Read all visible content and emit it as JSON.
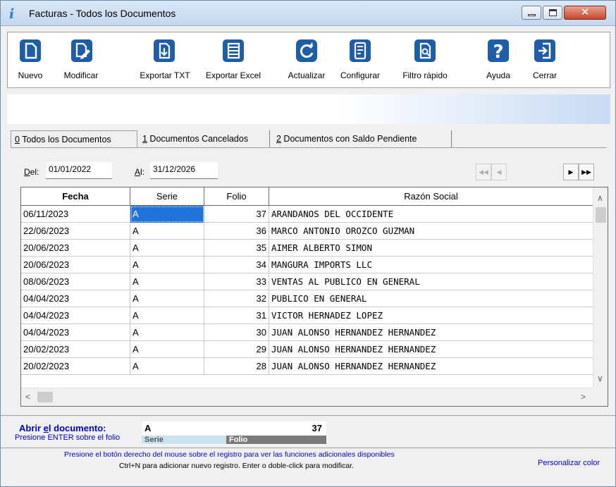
{
  "window": {
    "title": "Facturas - Todos los Documentos",
    "close_glyph": "✕"
  },
  "toolbar": {
    "buttons": [
      {
        "label": "Nuevo",
        "icon": "new-document-icon"
      },
      {
        "label": "Modificar",
        "icon": "edit-document-icon"
      },
      {
        "label": "Exportar TXT",
        "icon": "export-txt-icon"
      },
      {
        "label": "Exportar Excel",
        "icon": "export-excel-icon"
      },
      {
        "label": "Actualizar",
        "icon": "refresh-icon"
      },
      {
        "label": "Configurar",
        "icon": "configure-icon"
      },
      {
        "label": "Filtro rápido",
        "icon": "quick-filter-icon"
      },
      {
        "label": "Ayuda",
        "icon": "help-icon"
      },
      {
        "label": "Cerrar",
        "icon": "exit-door-icon"
      }
    ]
  },
  "tabs": [
    {
      "key": "0",
      "rest": " Todos los Documentos",
      "active": true
    },
    {
      "key": "1",
      "rest": " Documentos Cancelados",
      "active": false
    },
    {
      "key": "2",
      "rest": " Documentos con Saldo Pendiente",
      "active": false
    }
  ],
  "filters": {
    "del_key": "D",
    "del_rest": "el:",
    "del_value": "01/01/2022",
    "al_key": "A",
    "al_rest": "l:",
    "al_value": "31/12/2026"
  },
  "nav": {
    "first": "◀◀",
    "prev": "◀",
    "next": "▶",
    "last": "▶▶"
  },
  "grid": {
    "columns": [
      "Fecha",
      "Serie",
      "Folio",
      "Razón Social"
    ],
    "rows": [
      {
        "fecha": "06/11/2023",
        "serie": "A",
        "folio": "37",
        "razon": "ARANDANOS DEL OCCIDENTE"
      },
      {
        "fecha": "22/06/2023",
        "serie": "A",
        "folio": "36",
        "razon": "MARCO ANTONIO OROZCO GUZMAN"
      },
      {
        "fecha": "20/06/2023",
        "serie": "A",
        "folio": "35",
        "razon": "AIMER ALBERTO SIMON"
      },
      {
        "fecha": "20/06/2023",
        "serie": "A",
        "folio": "34",
        "razon": "MANGURA IMPORTS LLC"
      },
      {
        "fecha": "08/06/2023",
        "serie": "A",
        "folio": "33",
        "razon": "VENTAS AL PUBLICO EN GENERAL"
      },
      {
        "fecha": "04/04/2023",
        "serie": "A",
        "folio": "32",
        "razon": "PUBLICO EN GENERAL"
      },
      {
        "fecha": "04/04/2023",
        "serie": "A",
        "folio": "31",
        "razon": "VICTOR HERNADEZ LOPEZ"
      },
      {
        "fecha": "04/04/2023",
        "serie": "A",
        "folio": "30",
        "razon": "JUAN ALONSO HERNANDEZ HERNANDEZ"
      },
      {
        "fecha": "20/02/2023",
        "serie": "A",
        "folio": "29",
        "razon": "JUAN ALONSO HERNANDEZ HERNANDEZ"
      },
      {
        "fecha": "20/02/2023",
        "serie": "A",
        "folio": "28",
        "razon": "JUAN ALONSO HERNANDEZ HERNANDEZ"
      }
    ],
    "scroll_up": "∧",
    "scroll_down": "∨",
    "scroll_left": "<",
    "scroll_right": ">"
  },
  "open_document": {
    "label_before": "Abrir ",
    "label_key": "e",
    "label_after": "l documento:",
    "hint": "Presione ENTER sobre el folio",
    "serie_value": "A",
    "folio_value": "37",
    "serie_label": "Serie",
    "folio_label": "Folio"
  },
  "footer": {
    "line1": "Presione el botón derecho del mouse sobre el registro para ver las funciones adicionales disponibles",
    "line2": "Ctrl+N para adicionar nuevo registro. Enter o doble-click para modificar.",
    "personalizar": "Personalizar color"
  },
  "colors": {
    "selection": "#1f72d9",
    "toolbar_icon": "#1f5da6",
    "link_text": "#0000c0"
  }
}
